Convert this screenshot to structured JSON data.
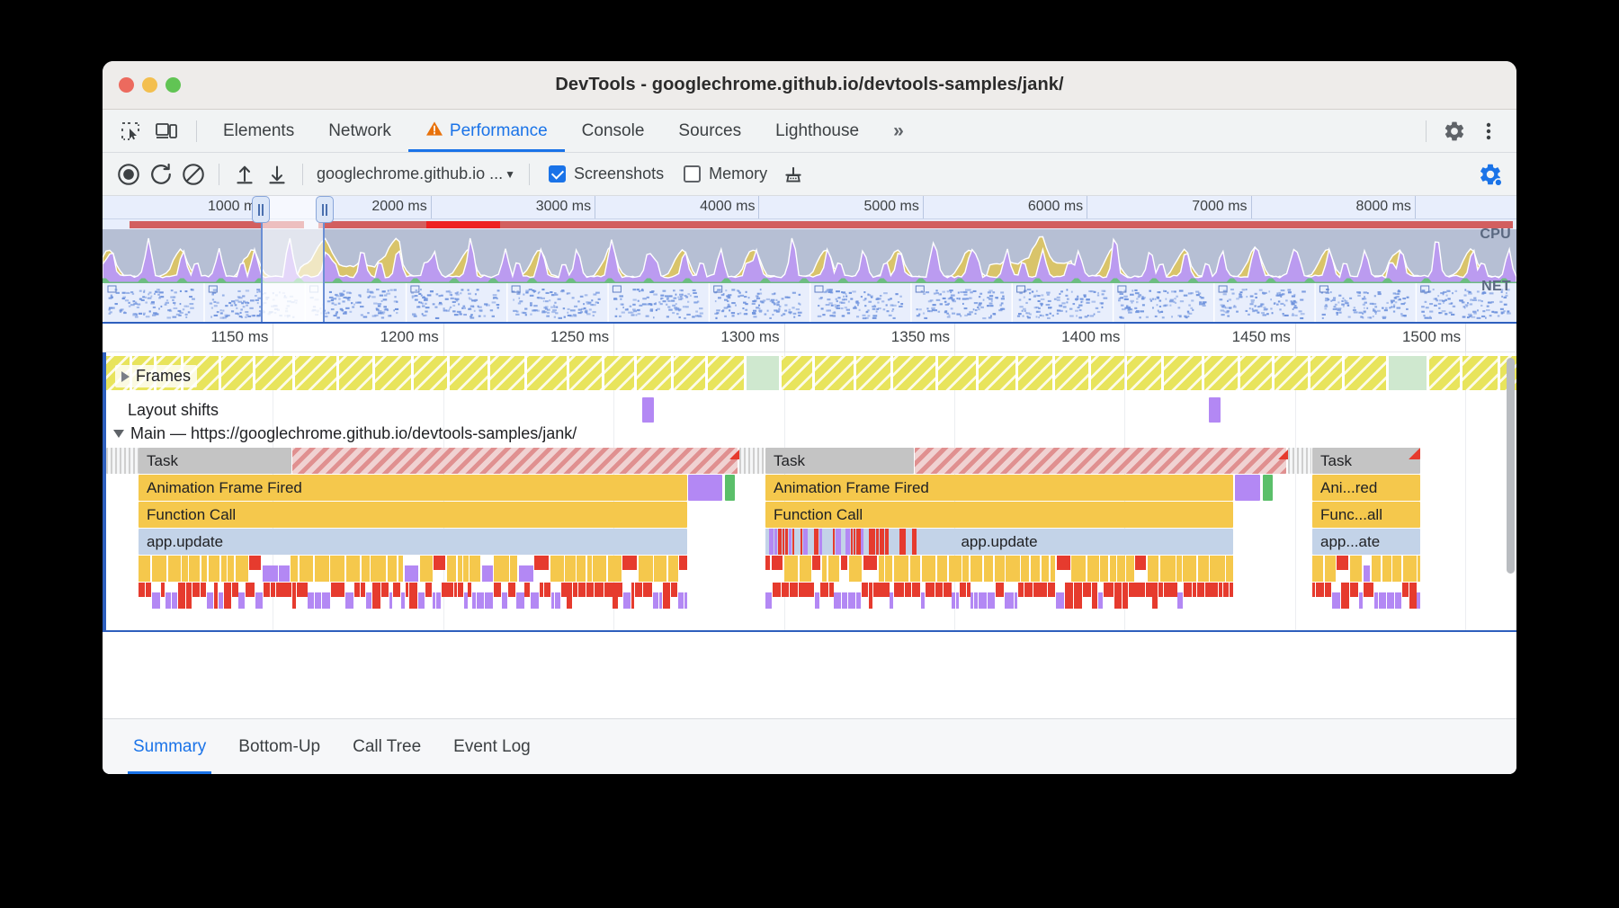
{
  "window": {
    "title": "DevTools - googlechrome.github.io/devtools-samples/jank/",
    "traffic_lights": [
      "close",
      "minimize",
      "zoom"
    ]
  },
  "tabbar": {
    "icons": [
      "inspect-element-icon",
      "device-toolbar-icon"
    ],
    "tabs": [
      {
        "label": "Elements",
        "active": false
      },
      {
        "label": "Network",
        "active": false
      },
      {
        "label": "Performance",
        "active": true,
        "warning": true
      },
      {
        "label": "Console",
        "active": false
      },
      {
        "label": "Sources",
        "active": false
      },
      {
        "label": "Lighthouse",
        "active": false
      }
    ],
    "more_label": "»",
    "right_icons": [
      "gear-icon",
      "kebab-menu-icon"
    ]
  },
  "perf_toolbar": {
    "record_icon": "record-icon",
    "reload_icon": "reload-record-icon",
    "clear_icon": "clear-icon",
    "load_icon": "load-profile-icon",
    "save_icon": "save-profile-icon",
    "url_select": "googlechrome.github.io ...",
    "url_caret": "▼",
    "screenshots_label": "Screenshots",
    "screenshots_checked": true,
    "memory_label": "Memory",
    "memory_checked": false,
    "gc_icon": "collect-garbage-icon",
    "settings_icon": "capture-settings-icon"
  },
  "overview": {
    "ticks": [
      "1000 ms",
      "2000 ms",
      "3000 ms",
      "4000 ms",
      "5000 ms",
      "6000 ms",
      "7000 ms",
      "8000 ms"
    ],
    "cpu_label": "CPU",
    "net_label": "NET",
    "selection": {
      "start_label": "",
      "end_label": ""
    }
  },
  "flamechart": {
    "ticks": [
      "1150 ms",
      "1200 ms",
      "1250 ms",
      "1300 ms",
      "1350 ms",
      "1400 ms",
      "1450 ms",
      "1500 ms"
    ],
    "tracks": [
      {
        "name": "Frames",
        "label": "Frames",
        "expanded": false
      },
      {
        "name": "Layout shifts",
        "label": "Layout shifts",
        "expanded": false
      },
      {
        "name": "Main",
        "label": "Main — https://googlechrome.github.io/devtools-samples/jank/",
        "expanded": true
      }
    ],
    "events": {
      "task_label": "Task",
      "animation_frame_label": "Animation Frame Fired",
      "function_call_label": "Function Call",
      "app_update_label": "app.update",
      "animation_frame_label_short": "Ani...red",
      "function_call_label_short": "Func...all",
      "app_update_label_short": "app...ate"
    }
  },
  "bottom_tabs": [
    {
      "label": "Summary",
      "active": true
    },
    {
      "label": "Bottom-Up",
      "active": false
    },
    {
      "label": "Call Tree",
      "active": false
    },
    {
      "label": "Event Log",
      "active": false
    }
  ],
  "colors": {
    "accent": "#1a73e8",
    "warning": "#e8710a",
    "frame": "#e8e45c",
    "scripting": "#f5c84c",
    "layout_shift": "#b388f4",
    "long_task": "#d25f5f"
  }
}
